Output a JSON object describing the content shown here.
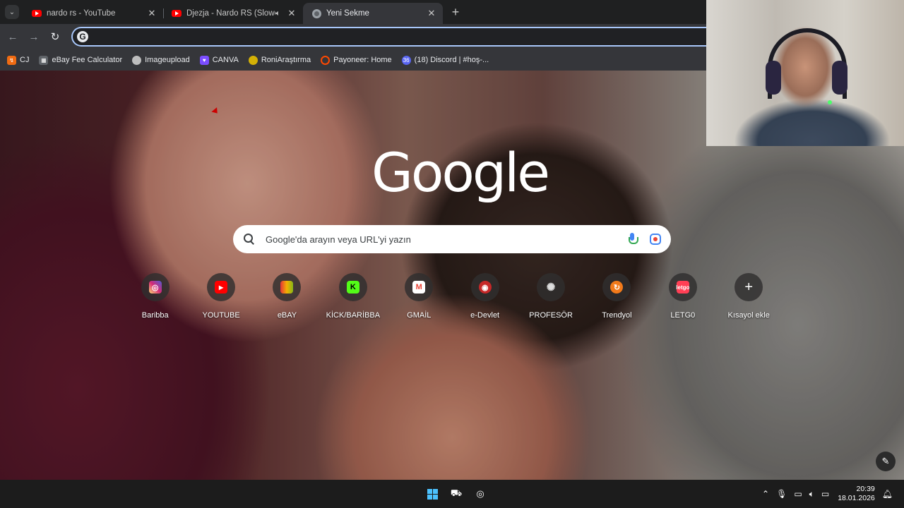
{
  "tabs": [
    {
      "title": "nardo rs - YouTube",
      "favicon": "youtube-icon",
      "active": false,
      "audio": false
    },
    {
      "title": "Djezja - Nardo RS (Slowed)",
      "favicon": "youtube-icon",
      "active": false,
      "audio": true
    },
    {
      "title": "Yeni Sekme",
      "favicon": "chrome-icon",
      "active": true,
      "audio": false
    }
  ],
  "omnibox": {
    "value": ""
  },
  "bookmarks": [
    {
      "label": "CJ",
      "icon": "cj-icon",
      "color": "#f06b12"
    },
    {
      "label": "eBay Fee Calculator",
      "icon": "calculator-icon",
      "color": "#5f6368"
    },
    {
      "label": "Imageupload",
      "icon": "upload-icon",
      "color": "#bdbdbd"
    },
    {
      "label": "CANVA",
      "icon": "heart-icon",
      "color": "#7b4dff"
    },
    {
      "label": "RoniAraştırma",
      "icon": "pacman-icon",
      "color": "#d4b106"
    },
    {
      "label": "Payoneer: Home",
      "icon": "payoneer-icon",
      "color": "#ff4800"
    },
    {
      "label": "(18) Discord | #hoş-...",
      "icon": "discord-icon",
      "color": "#5865f2",
      "badge": "36"
    }
  ],
  "ntp": {
    "logo": "Google",
    "search_placeholder": "Google'da arayın veya URL'yi yazın",
    "shortcuts": [
      {
        "label": "Baribba",
        "icon": "instagram-icon",
        "color": "#e1306c",
        "glyph": "◎"
      },
      {
        "label": "YOUTUBE",
        "icon": "youtube-icon",
        "color": "#ff0000",
        "glyph": "▶"
      },
      {
        "label": "eBAY",
        "icon": "ebay-icon",
        "color": "#3a8f3a",
        "glyph": "e"
      },
      {
        "label": "KİCK/BARİBBA",
        "icon": "kick-icon",
        "color": "#53fc18",
        "glyph": "K"
      },
      {
        "label": "GMAİL",
        "icon": "gmail-icon",
        "color": "#ea4335",
        "glyph": "M"
      },
      {
        "label": "e-Devlet",
        "icon": "edevlet-icon",
        "color": "#c62828",
        "glyph": "◉"
      },
      {
        "label": "PROFESÖR",
        "icon": "openai-icon",
        "color": "#8a8a8a",
        "glyph": "✺"
      },
      {
        "label": "Trendyol",
        "icon": "trendyol-icon",
        "color": "#f27a1a",
        "glyph": "↻"
      },
      {
        "label": "LETG0",
        "icon": "letgo-icon",
        "color": "#ff3f55",
        "glyph": "l"
      },
      {
        "label": "Kısayol ekle",
        "icon": "plus-icon",
        "color": "#3c3c3c",
        "glyph": "+"
      }
    ]
  },
  "taskbar": {
    "time": "20:39",
    "date": "18.01.2026"
  }
}
